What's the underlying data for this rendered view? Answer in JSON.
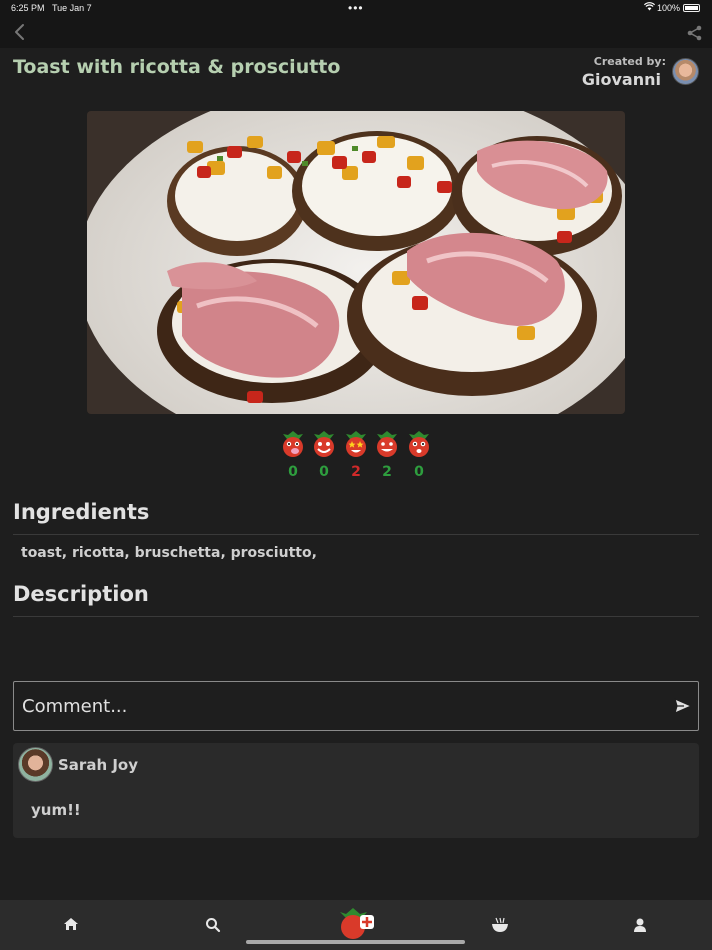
{
  "status_bar": {
    "time": "6:25 PM",
    "date": "Tue Jan 7",
    "battery": "100%"
  },
  "nav": {
    "back_icon": "chevron-left-icon",
    "share_icon": "share-icon"
  },
  "recipe": {
    "title": "Toast with ricotta & prosciutto",
    "created_label": "Created by:",
    "creator": "Giovanni"
  },
  "reactions": [
    {
      "icon": "tomato-drooling-icon",
      "count": "0",
      "color": "#2e9e3e"
    },
    {
      "icon": "tomato-happy-icon",
      "count": "0",
      "color": "#2e9e3e"
    },
    {
      "icon": "tomato-star-eyes-icon",
      "count": "2",
      "color": "#d12a2a"
    },
    {
      "icon": "tomato-smile-icon",
      "count": "2",
      "color": "#2e9e3e"
    },
    {
      "icon": "tomato-surprised-icon",
      "count": "0",
      "color": "#2e9e3e"
    }
  ],
  "ingredients": {
    "heading": "Ingredients",
    "text": "toast, ricotta, bruschetta, prosciutto,"
  },
  "description": {
    "heading": "Description",
    "text": ""
  },
  "comment_input": {
    "placeholder": "Comment..."
  },
  "comments": [
    {
      "author": "Sarah Joy",
      "text": "yum!!"
    }
  ],
  "tab_bar": {
    "tabs": [
      "home-icon",
      "search-icon",
      "add-recipe-icon",
      "bowl-icon",
      "profile-icon"
    ]
  },
  "colors": {
    "title": "#b6cfb0",
    "background": "#1e1e1e",
    "green_count": "#2e9e3e",
    "red_count": "#d12a2a"
  }
}
